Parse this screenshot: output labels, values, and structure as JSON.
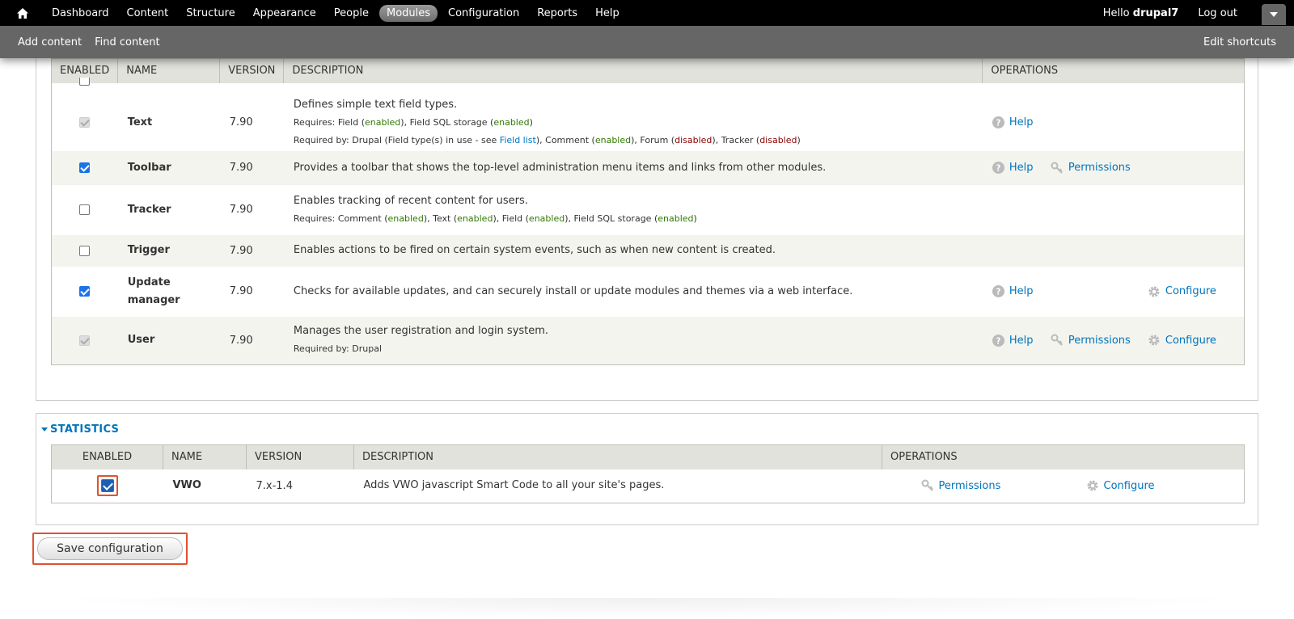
{
  "toolbar": {
    "nav": [
      "Dashboard",
      "Content",
      "Structure",
      "Appearance",
      "People",
      "Modules",
      "Configuration",
      "Reports",
      "Help"
    ],
    "active": "Modules",
    "hello_prefix": "Hello ",
    "username": "drupal7",
    "logout": "Log out",
    "shortcuts": [
      "Add content",
      "Find content"
    ],
    "edit_shortcuts": "Edit shortcuts"
  },
  "core_table": {
    "headers": {
      "enabled": "ENABLED",
      "name": "NAME",
      "version": "VERSION",
      "description": "DESCRIPTION",
      "operations": "OPERATIONS"
    },
    "rows": {
      "text": {
        "name": "Text",
        "version": "7.90",
        "desc": "Defines simple text field types.",
        "req_label": "Requires: ",
        "field": "Field",
        "field_sql": "Field SQL storage",
        "reqby_label": "Required by: ",
        "reqby_drupal": "Drupal (Field type(s) in use - see ",
        "field_list": "Field list",
        "comment": "Comment",
        "forum": "Forum",
        "tracker": "Tracker",
        "help": "Help"
      },
      "toolbar": {
        "name": "Toolbar",
        "version": "7.90",
        "desc": "Provides a toolbar that shows the top-level administration menu items and links from other modules.",
        "help": "Help",
        "permissions": "Permissions"
      },
      "tracker": {
        "name": "Tracker",
        "version": "7.90",
        "desc": "Enables tracking of recent content for users.",
        "req_label": "Requires: ",
        "comment": "Comment",
        "text": "Text",
        "field": "Field",
        "field_sql": "Field SQL storage"
      },
      "trigger": {
        "name": "Trigger",
        "version": "7.90",
        "desc": "Enables actions to be fired on certain system events, such as when new content is created."
      },
      "update": {
        "name_line1": "Update",
        "name_line2": "manager",
        "version": "7.90",
        "desc": "Checks for available updates, and can securely install or update modules and themes via a web interface.",
        "help": "Help",
        "configure": "Configure"
      },
      "user": {
        "name": "User",
        "version": "7.90",
        "desc": "Manages the user registration and login system.",
        "reqby": "Required by: Drupal",
        "help": "Help",
        "permissions": "Permissions",
        "configure": "Configure"
      }
    },
    "enabled_word": "enabled",
    "disabled_word": "disabled"
  },
  "stats": {
    "legend": "STATISTICS",
    "headers": {
      "enabled": "ENABLED",
      "name": "NAME",
      "version": "VERSION",
      "description": "DESCRIPTION",
      "operations": "OPERATIONS"
    },
    "row": {
      "name": "VWO",
      "version": "7.x-1.4",
      "desc": "Adds VWO javascript Smart Code to all your site's pages.",
      "permissions": "Permissions",
      "configure": "Configure"
    }
  },
  "save_button": "Save configuration",
  "colors": {
    "link": "#0074bd",
    "enabled": "#2f7a00",
    "disabled": "#8b0000",
    "highlight": "#e0522f"
  }
}
